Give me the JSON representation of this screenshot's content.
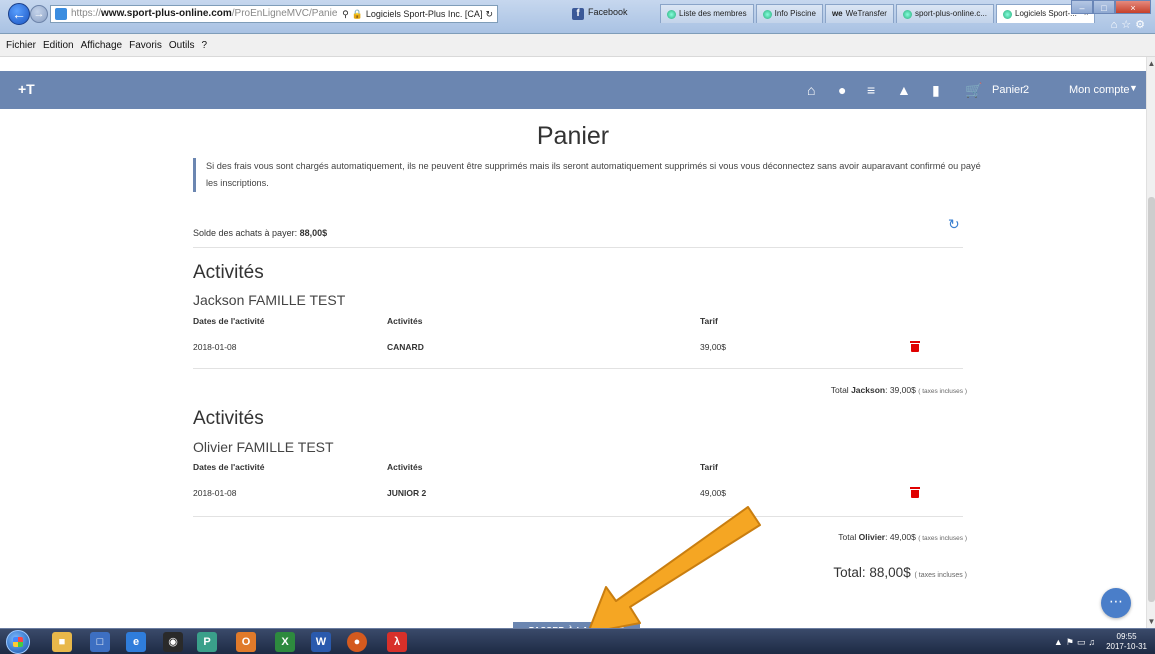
{
  "browser": {
    "url_protocol": "https://",
    "url_host": "www.sport-plus-online.com",
    "url_path": "/ProEnLigneMVC/Panier/Index",
    "address_suffix": "Logiciels Sport-Plus Inc. [CA]",
    "favorites_bar": {
      "facebook_label": "Facebook"
    },
    "tabs": [
      {
        "label": "Liste des membres"
      },
      {
        "label": "Info Piscine"
      },
      {
        "label": "WeTransfer"
      },
      {
        "label": "sport-plus-online.c..."
      },
      {
        "label": "Logiciels Sport-..."
      }
    ],
    "menu": [
      "Fichier",
      "Edition",
      "Affichage",
      "Favoris",
      "Outils",
      "?"
    ]
  },
  "header": {
    "logo": "+T",
    "cart_label": "Panier",
    "cart_count": "2",
    "account_label": "Mon compte"
  },
  "page": {
    "title": "Panier",
    "notice": "Si des frais vous sont chargés automatiquement, ils ne peuvent être supprimés mais ils seront automatiquement supprimés si vous vous déconnectez sans avoir auparavant confirmé ou payé les inscriptions.",
    "balance_label": "Solde des achats à payer:",
    "balance_value": "88,00$"
  },
  "sections": [
    {
      "title": "Activités",
      "person": "Jackson FAMILLE TEST",
      "col_dates": "Dates de l'activité",
      "col_activity": "Activités",
      "col_price": "Tarif",
      "row": {
        "date": "2018-01-08",
        "activity": "CANARD",
        "price": "39,00$"
      },
      "total_prefix": "Total",
      "total_name": "Jackson",
      "total_value": ": 39,00$",
      "tax_note": "( taxes incluses )"
    },
    {
      "title": "Activités",
      "person": "Olivier FAMILLE TEST",
      "col_dates": "Dates de l'activité",
      "col_activity": "Activités",
      "col_price": "Tarif",
      "row": {
        "date": "2018-01-08",
        "activity": "JUNIOR 2",
        "price": "49,00$"
      },
      "total_prefix": "Total",
      "total_name": "Olivier",
      "total_value": ": 49,00$",
      "tax_note": "( taxes incluses )"
    }
  ],
  "grand_total": {
    "label": "Total: 88,00$",
    "tax_note": "( taxes incluses )"
  },
  "checkout_button": "PASSER À LA CAISSE",
  "taskbar": {
    "time": "09:55",
    "date": "2017-10-31"
  },
  "colors": {
    "header": "#6b86b1",
    "accent_blue": "#3a7fd0",
    "delete_red": "#e00000",
    "arrow": "#f5a623"
  }
}
